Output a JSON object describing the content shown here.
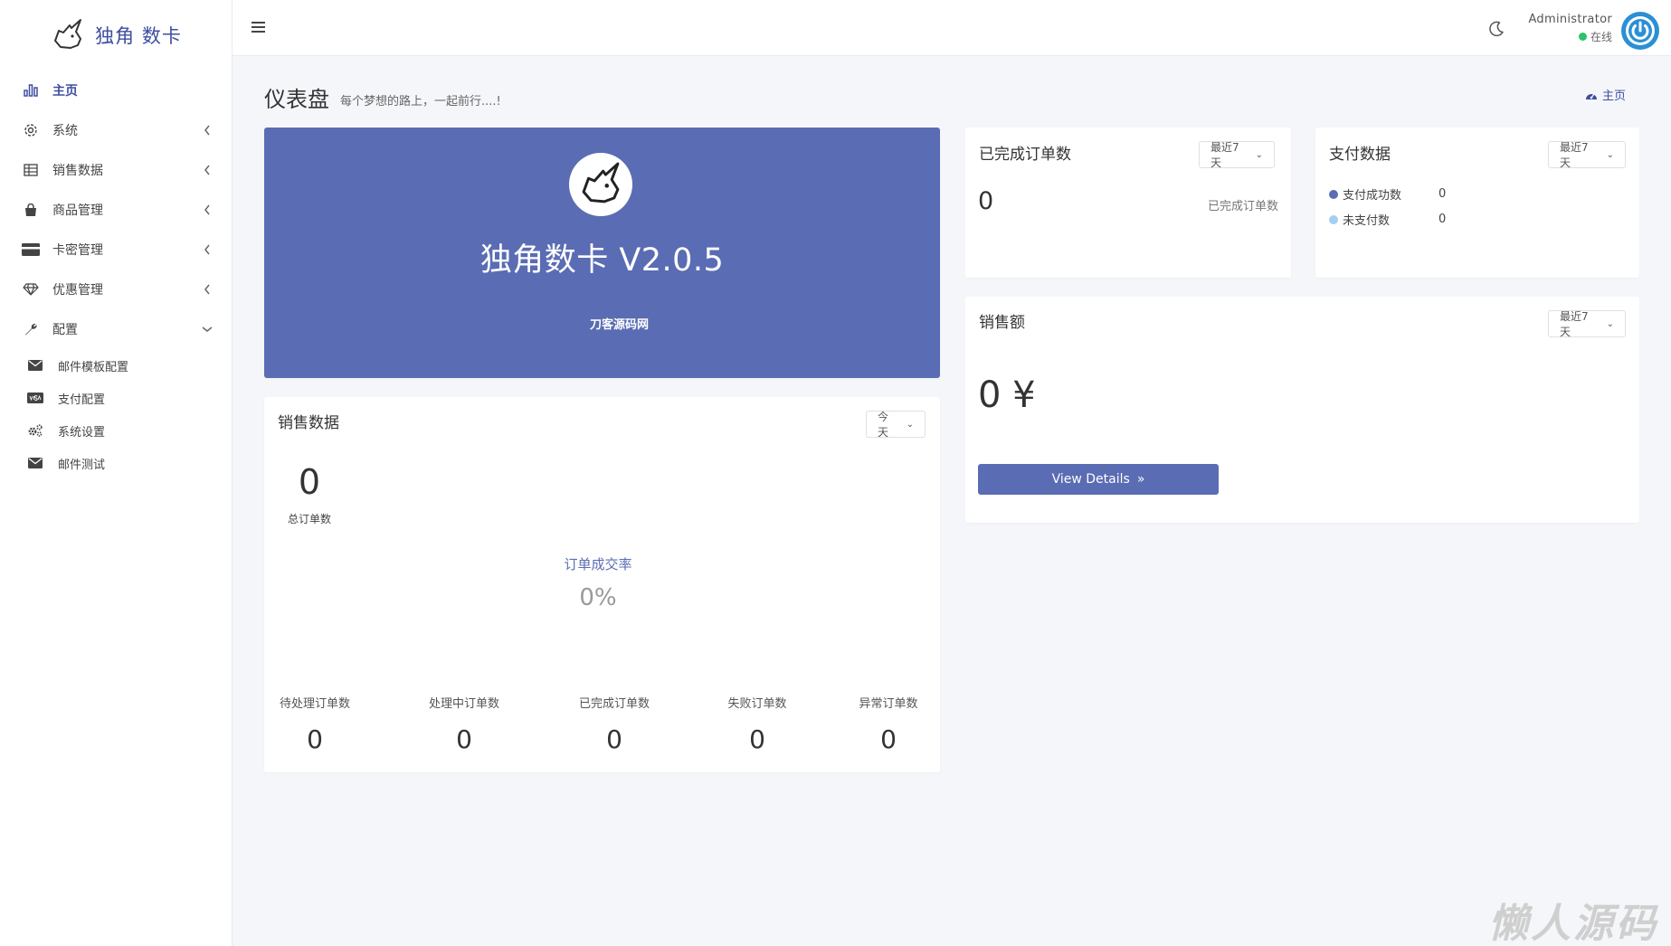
{
  "brand": {
    "name": "独角 数卡"
  },
  "sidebar": {
    "items": [
      {
        "label": "主页",
        "icon": "bar-chart-icon",
        "active": true
      },
      {
        "label": "系统",
        "icon": "gear-icon"
      },
      {
        "label": "销售数据",
        "icon": "table-icon"
      },
      {
        "label": "商品管理",
        "icon": "shopping-bag-icon"
      },
      {
        "label": "卡密管理",
        "icon": "credit-card-icon"
      },
      {
        "label": "优惠管理",
        "icon": "diamond-icon"
      },
      {
        "label": "配置",
        "icon": "wrench-icon",
        "expanded": true
      }
    ],
    "subitems": [
      {
        "label": "邮件模板配置",
        "icon": "envelope-icon"
      },
      {
        "label": "支付配置",
        "icon": "visa-card-icon"
      },
      {
        "label": "系统设置",
        "icon": "cogs-icon"
      },
      {
        "label": "邮件测试",
        "icon": "envelope-icon"
      }
    ]
  },
  "topbar": {
    "user_name": "Administrator",
    "user_status": "在线"
  },
  "page": {
    "title": "仪表盘",
    "subtitle": "每个梦想的路上，一起前行....!",
    "breadcrumb": "主页"
  },
  "hero": {
    "title": "独角数卡 V2.0.5",
    "subtitle": "刀客源码网"
  },
  "completed_orders": {
    "title": "已完成订单数",
    "range": "最近7天",
    "value": "0",
    "label": "已完成订单数"
  },
  "payment": {
    "title": "支付数据",
    "range": "最近7天",
    "rows": [
      {
        "label": "支付成功数",
        "value": "0",
        "color": "#5a6cb3"
      },
      {
        "label": "未支付数",
        "value": "0",
        "color": "#a3cff2"
      }
    ]
  },
  "sales_amount": {
    "title": "销售额",
    "range": "最近7天",
    "value": "0 ¥",
    "button": "View Details"
  },
  "sales_data": {
    "title": "销售数据",
    "range": "今天",
    "total_value": "0",
    "total_label": "总订单数",
    "rate_label": "订单成交率",
    "rate_value": "0%",
    "stats": [
      {
        "label": "待处理订单数",
        "value": "0"
      },
      {
        "label": "处理中订单数",
        "value": "0"
      },
      {
        "label": "已完成订单数",
        "value": "0"
      },
      {
        "label": "失败订单数",
        "value": "0"
      },
      {
        "label": "异常订单数",
        "value": "0"
      }
    ]
  },
  "watermark": "懒人源码",
  "colors": {
    "accent": "#5a6cb3",
    "brand": "#3e4ea1",
    "online": "#2cc36b",
    "unpaid": "#a3cff2"
  }
}
